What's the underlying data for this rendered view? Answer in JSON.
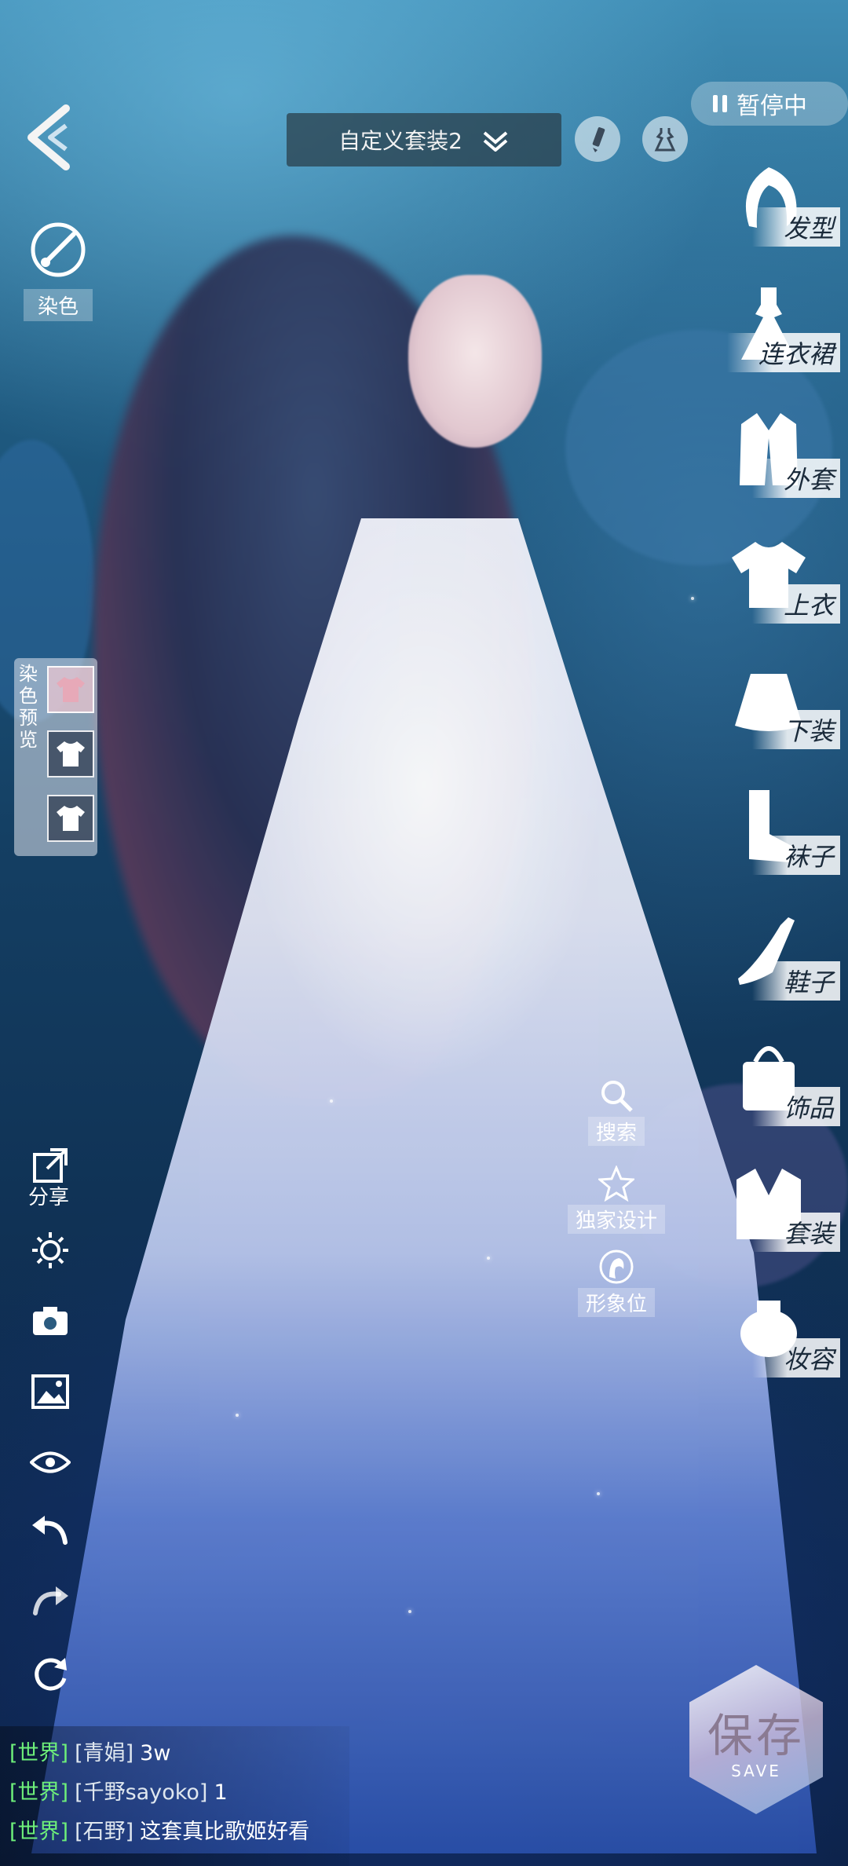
{
  "topbar": {
    "outfit_name": "自定义套装2",
    "pause_label": "暂停中"
  },
  "dye": {
    "label": "染色",
    "preview_label": "染色预览"
  },
  "left_tools": {
    "share_label": "分享"
  },
  "categories": [
    {
      "label": "发型",
      "icon": "hair-icon"
    },
    {
      "label": "连衣裙",
      "icon": "dress-icon"
    },
    {
      "label": "外套",
      "icon": "coat-icon"
    },
    {
      "label": "上衣",
      "icon": "top-icon"
    },
    {
      "label": "下装",
      "icon": "skirt-icon"
    },
    {
      "label": "袜子",
      "icon": "socks-icon"
    },
    {
      "label": "鞋子",
      "icon": "shoe-icon"
    },
    {
      "label": "饰品",
      "icon": "bag-icon"
    },
    {
      "label": "套装",
      "icon": "suit-icon"
    },
    {
      "label": "妆容",
      "icon": "makeup-icon"
    }
  ],
  "mid_menu": {
    "search_label": "搜索",
    "exclusive_label": "独家设计",
    "image_label": "形象位"
  },
  "chat": [
    {
      "channel": "[世界]",
      "name": "[青娟]",
      "msg": "3w"
    },
    {
      "channel": "[世界]",
      "name": "[千野sayoko]",
      "msg": "1"
    },
    {
      "channel": "[世界]",
      "name": "[石野]",
      "msg": "这套真比歌姬好看"
    }
  ],
  "save": {
    "label": "保存",
    "sub": "SAVE"
  }
}
